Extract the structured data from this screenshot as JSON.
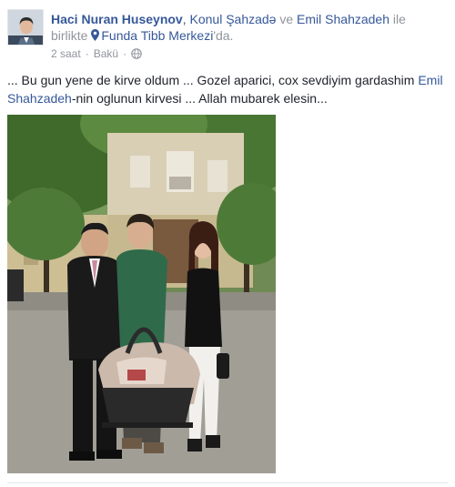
{
  "post": {
    "author": "Haci Nuran Huseynov",
    "tag_sep1": ", ",
    "tag_person1": "Konul Şahzadə",
    "tag_and": " ve ",
    "tag_person2": "Emil Shahzadeh",
    "tag_with_text": " ile birlikte ",
    "location": "Funda Tibb Merkezi",
    "location_suffix": "'da.",
    "time": "2 saat",
    "dot": "·",
    "place": "Bakü",
    "privacy_icon": "globe-icon",
    "text_part1": "... Bu gun yene de kirve oldum ... Gozel aparici, cox sevdiyim gardashim ",
    "text_link": "Emil Shahzadeh",
    "text_part2": "-nin oglunun kirvesi ... Allah mubarek elesin...",
    "colors": {
      "link": "#365899",
      "muted": "#90949c",
      "text": "#1d2129"
    }
  }
}
